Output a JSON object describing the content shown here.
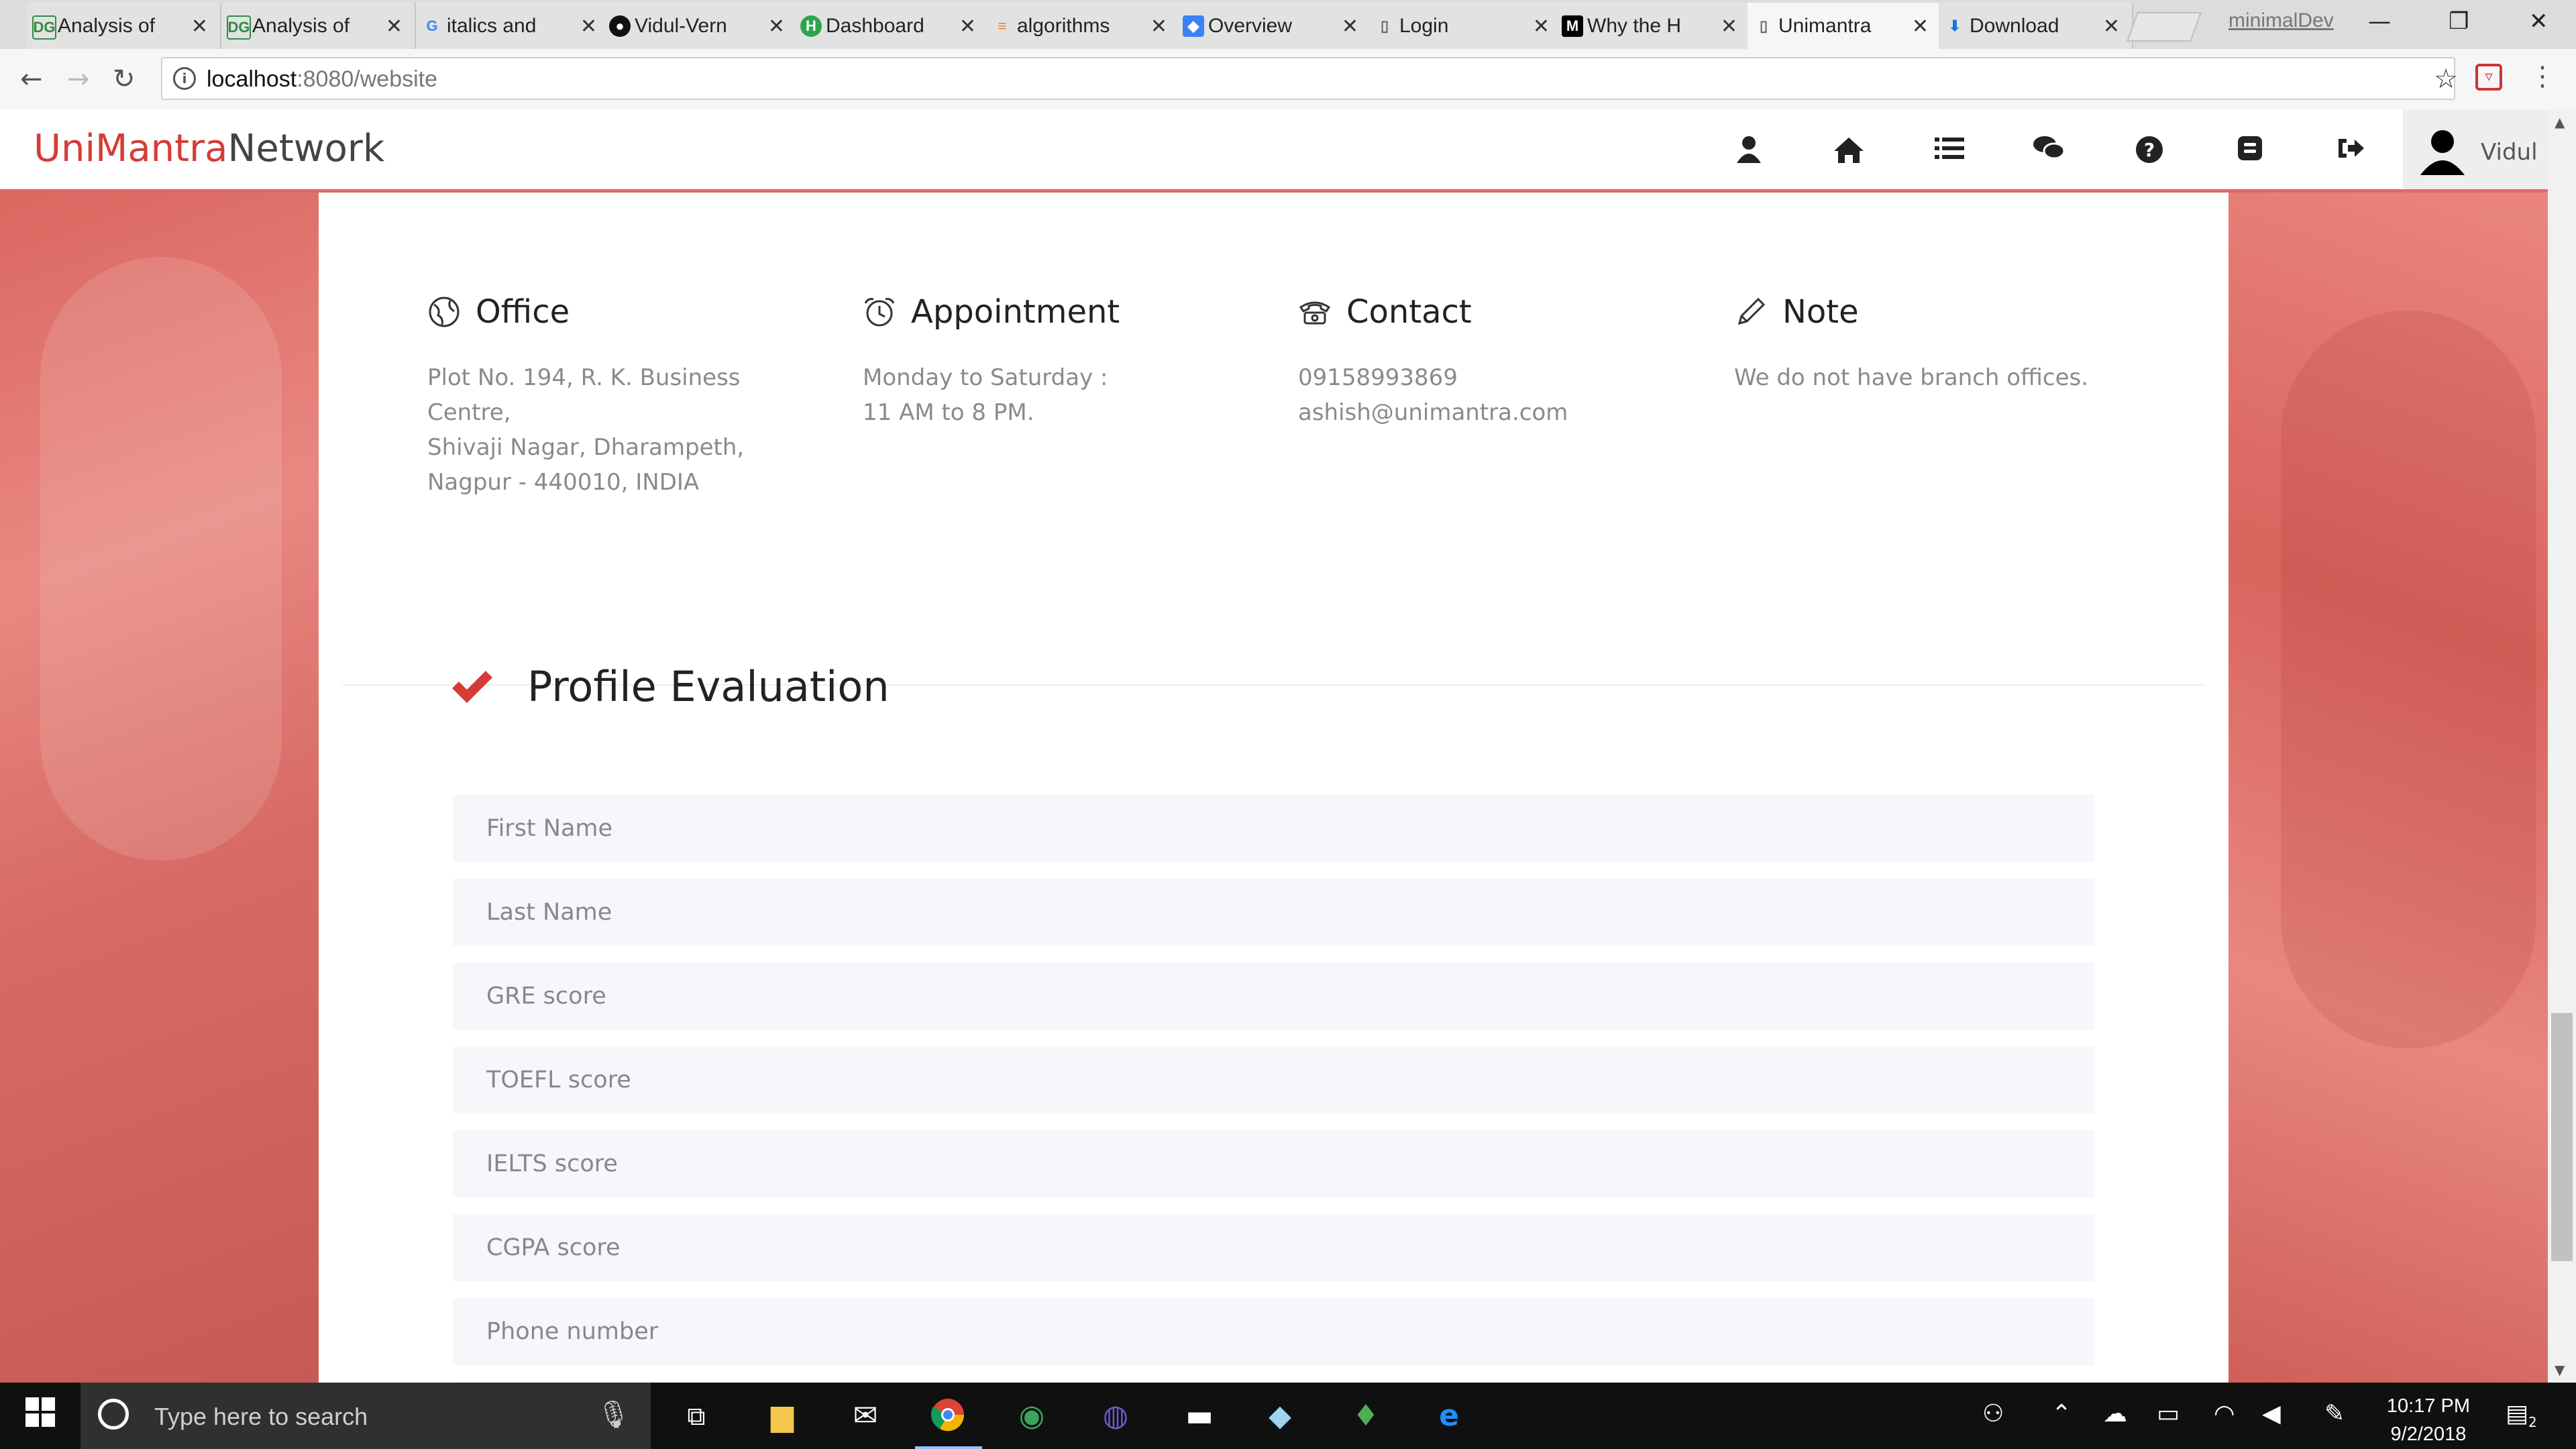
{
  "browser": {
    "tabs": [
      {
        "label": "Analysis of",
        "favicon": "DG",
        "favicon_color": "#2f8d46"
      },
      {
        "label": "Analysis of",
        "favicon": "DG",
        "favicon_color": "#2f8d46"
      },
      {
        "label": "italics and",
        "favicon": "G",
        "favicon_color": "#4285f4"
      },
      {
        "label": "Vidul-Vern",
        "favicon": "github",
        "favicon_color": "#111111"
      },
      {
        "label": "Dashboard",
        "favicon": "H",
        "favicon_color": "#2ea44f"
      },
      {
        "label": "algorithms",
        "favicon": "stack",
        "favicon_color": "#f48024"
      },
      {
        "label": "Overview",
        "favicon": "shield",
        "favicon_color": "#3b82f6"
      },
      {
        "label": "Login",
        "favicon": "page",
        "favicon_color": "#666666"
      },
      {
        "label": "Why the H",
        "favicon": "M",
        "favicon_color": "#000000"
      },
      {
        "label": "Unimantra",
        "favicon": "page",
        "favicon_color": "#666666",
        "active": true
      },
      {
        "label": "Download",
        "favicon": "download",
        "favicon_color": "#1a73e8"
      }
    ],
    "profile_name": "minimalDev",
    "url_host": "localhost",
    "url_rest": ":8080/website"
  },
  "site": {
    "brand_part1": "UniMantra",
    "brand_part2": "Network",
    "brand_color": "#d53c36",
    "nav_icons": [
      "user-icon",
      "home-icon",
      "list-icon",
      "chat-icon",
      "help-icon",
      "blogger-icon",
      "logout-icon"
    ],
    "user_name": "Vidul"
  },
  "info": {
    "office": {
      "title": "Office",
      "lines": [
        "Plot No. 194, R. K. Business Centre,",
        "Shivaji Nagar, Dharampeth,",
        "Nagpur - 440010, INDIA"
      ]
    },
    "appointment": {
      "title": "Appointment",
      "lines": [
        "Monday to Saturday :",
        "11 AM to 8 PM."
      ]
    },
    "contact": {
      "title": "Contact",
      "lines": [
        "09158993869",
        "ashish@unimantra.com"
      ]
    },
    "note": {
      "title": "Note",
      "lines": [
        "We do not have branch offices."
      ]
    }
  },
  "profile_evaluation": {
    "title": "Profile Evaluation",
    "fields": [
      "First Name",
      "Last Name",
      "GRE score",
      "TOEFL score",
      "IELTS score",
      "CGPA score",
      "Phone number"
    ]
  },
  "taskbar": {
    "search_placeholder": "Type here to search",
    "time": "10:17 PM",
    "date": "9/2/2018",
    "notification_count": "2"
  }
}
